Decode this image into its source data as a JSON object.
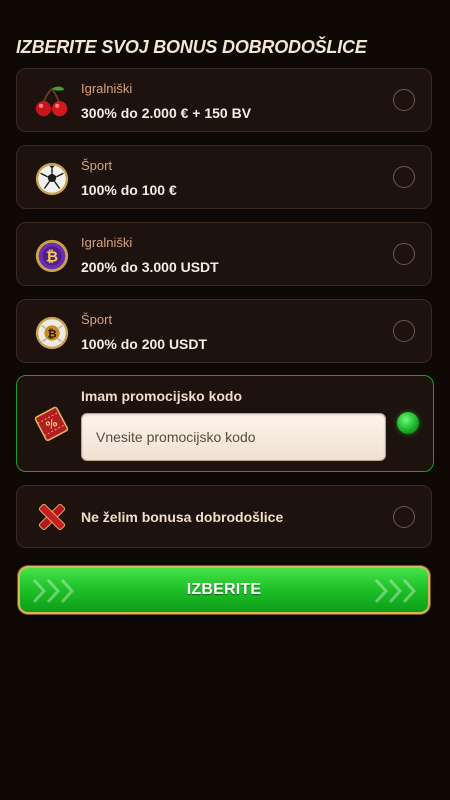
{
  "header": {
    "title": "IZBERITE SVOJ BONUS DOBRODOŠLICE"
  },
  "bonuses": [
    {
      "category": "Igralniški",
      "offer": "300% do 2.000 € + 150 BV",
      "icon": "cherries-icon",
      "selected": false
    },
    {
      "category": "Šport",
      "offer": "100% do 100 €",
      "icon": "soccer-ball-icon",
      "selected": false
    },
    {
      "category": "Igralniški",
      "offer": "200% do 3.000 USDT",
      "icon": "bitcoin-coin-icon",
      "selected": false
    },
    {
      "category": "Šport",
      "offer": "100% do 200 USDT",
      "icon": "bitcoin-soccer-ball-icon",
      "selected": false
    }
  ],
  "promo": {
    "label": "Imam promocijsko kodo",
    "placeholder": "Vnesite promocijsko kodo",
    "value": "",
    "icon": "promo-ticket-icon",
    "selected": true
  },
  "no_bonus": {
    "label": "Ne želim bonusa dobrodošlice",
    "icon": "red-cross-icon",
    "selected": false
  },
  "submit": {
    "label": "IZBERITE"
  },
  "colors": {
    "background": "#0f0906",
    "card": "#1d120d",
    "accent_green": "#21c22a",
    "gold_border": "#d9b55a",
    "category_text": "#d7a27d"
  }
}
